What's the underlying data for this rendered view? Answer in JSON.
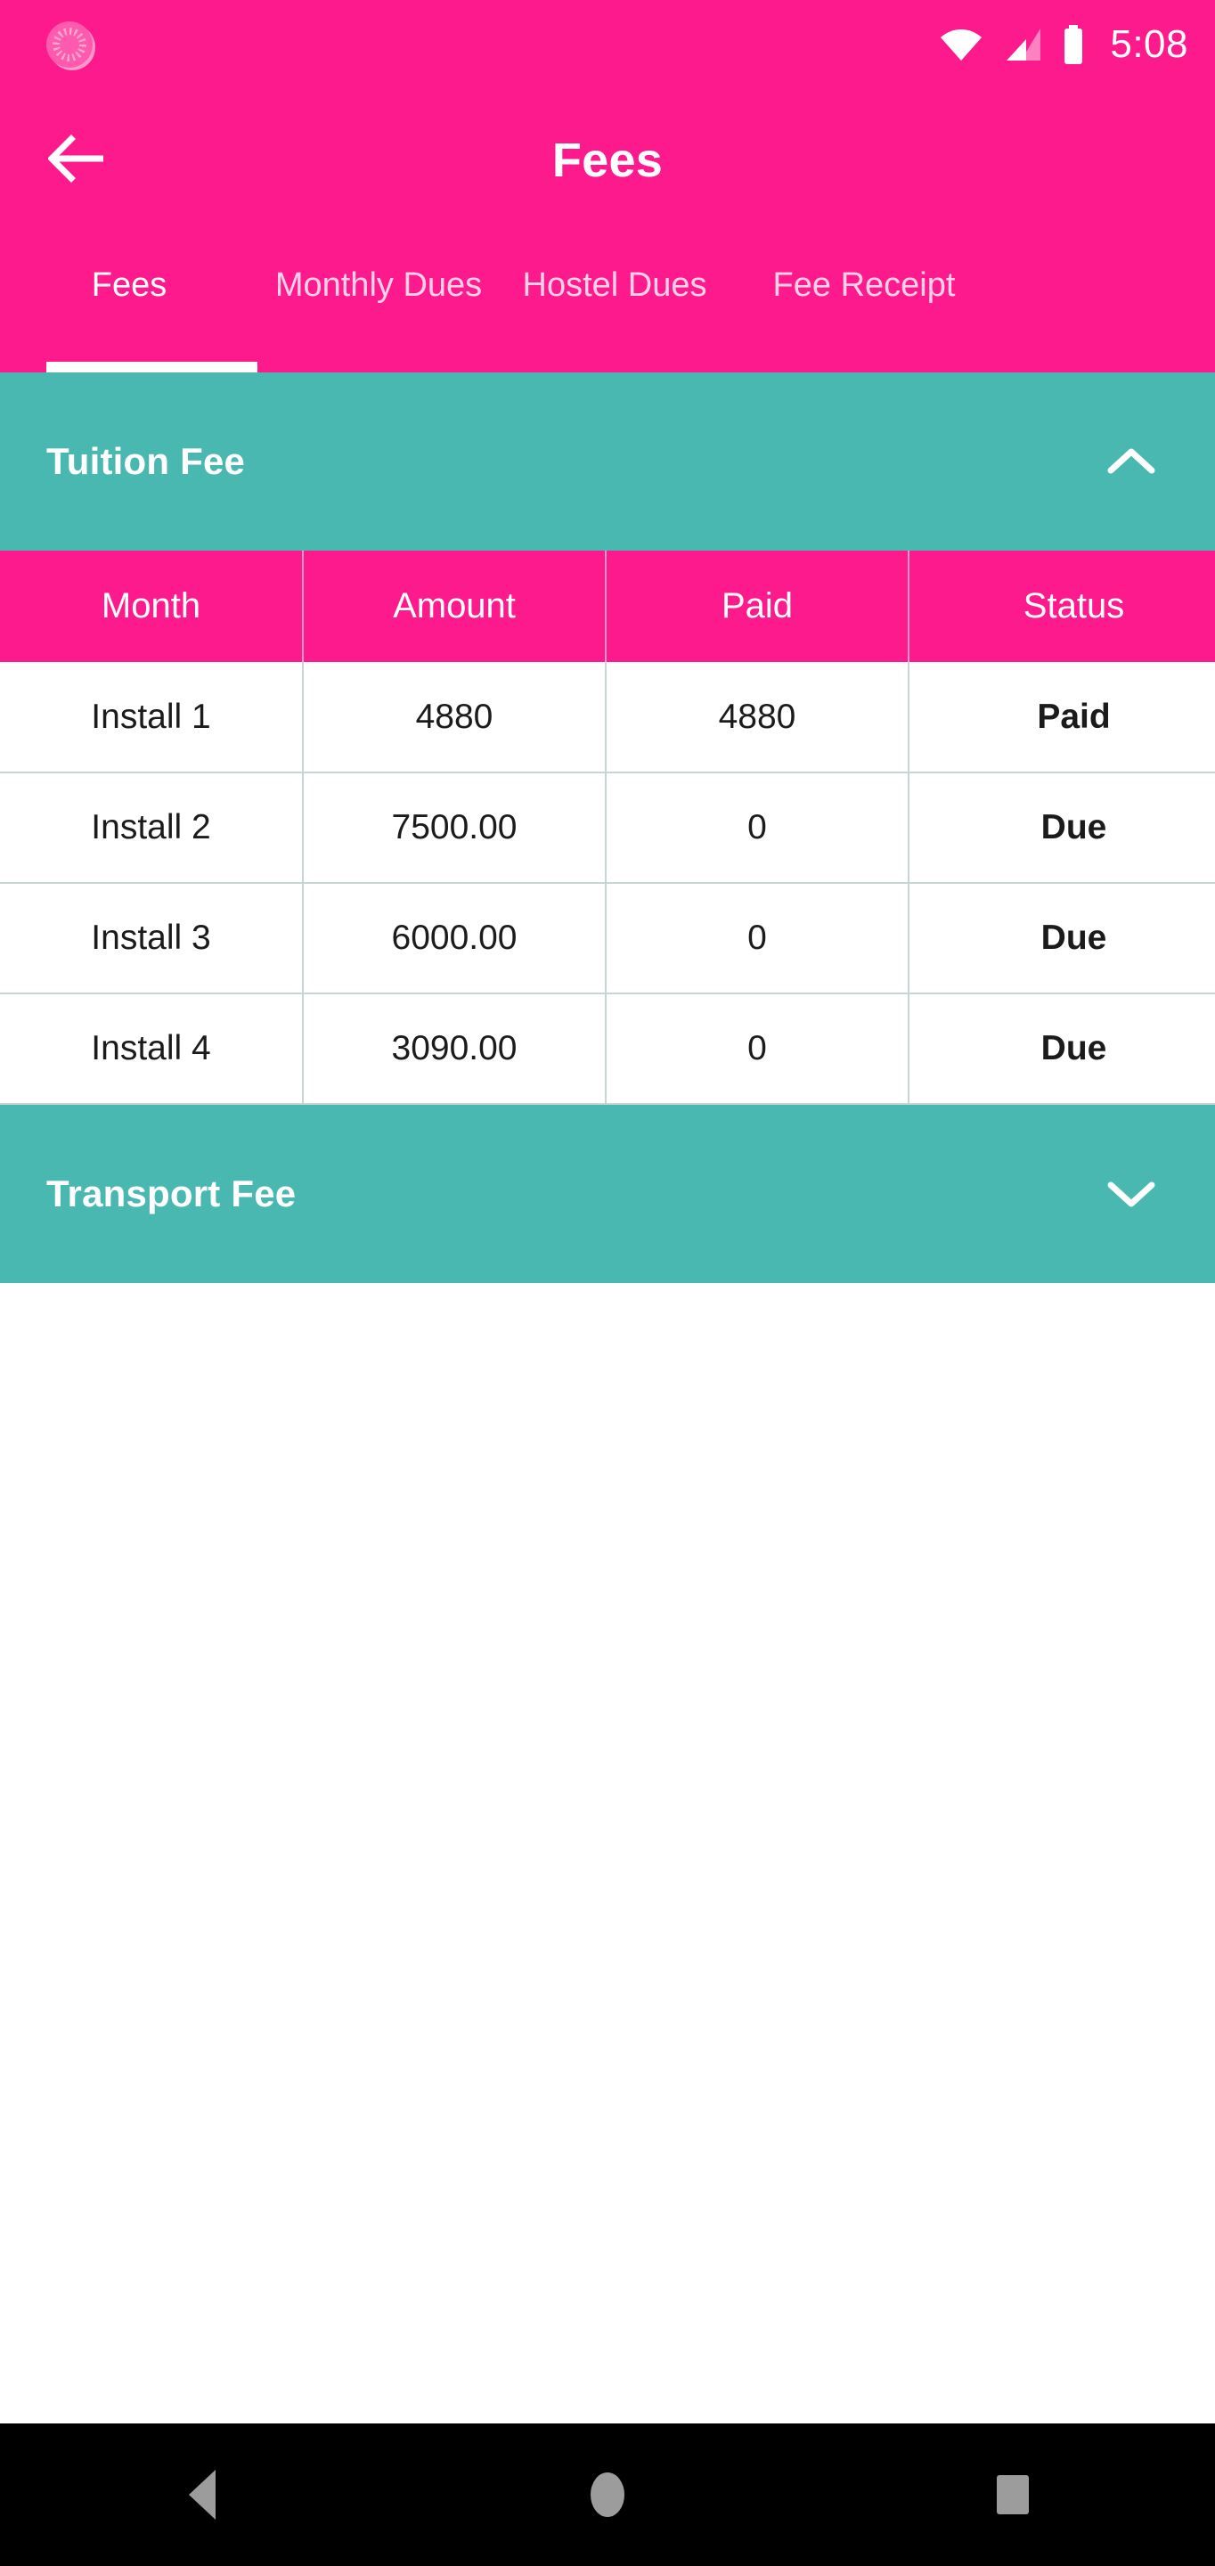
{
  "status_bar": {
    "notification_icon": "brightness-circle-icon",
    "wifi_icon": "wifi-icon",
    "signal_icon": "signal-bars-icon",
    "battery_icon": "battery-full-icon",
    "time": "5:08"
  },
  "app_bar": {
    "back_icon": "arrow-left-icon",
    "title": "Fees"
  },
  "tabs": {
    "active_index": 0,
    "items": [
      {
        "label": "Fees"
      },
      {
        "label": "Monthly Dues"
      },
      {
        "label": "Hostel Dues"
      },
      {
        "label": "Fee Receipt"
      }
    ]
  },
  "sections": [
    {
      "title": "Tuition Fee",
      "expanded": true,
      "chevron_icon": "chevron-up-icon"
    },
    {
      "title": "Transport Fee",
      "expanded": false,
      "chevron_icon": "chevron-down-icon"
    }
  ],
  "fee_table": {
    "columns": [
      "Month",
      "Amount",
      "Paid",
      "Status"
    ],
    "rows": [
      {
        "month": "Install 1",
        "amount": "4880",
        "paid": "4880",
        "status": "Paid"
      },
      {
        "month": "Install 2",
        "amount": "7500.00",
        "paid": "0",
        "status": "Due"
      },
      {
        "month": "Install 3",
        "amount": "6000.00",
        "paid": "0",
        "status": "Due"
      },
      {
        "month": "Install 4",
        "amount": "3090.00",
        "paid": "0",
        "status": "Due"
      }
    ]
  },
  "nav_bar": {
    "back_icon": "nav-back-triangle-icon",
    "home_icon": "nav-home-circle-icon",
    "recents_icon": "nav-recents-square-icon"
  },
  "colors": {
    "primary_pink": "#FD1A8C",
    "section_teal": "#48B8B0",
    "status_paid": "#2E9B48",
    "status_due": "#FF0000",
    "nav_background": "#000000"
  }
}
